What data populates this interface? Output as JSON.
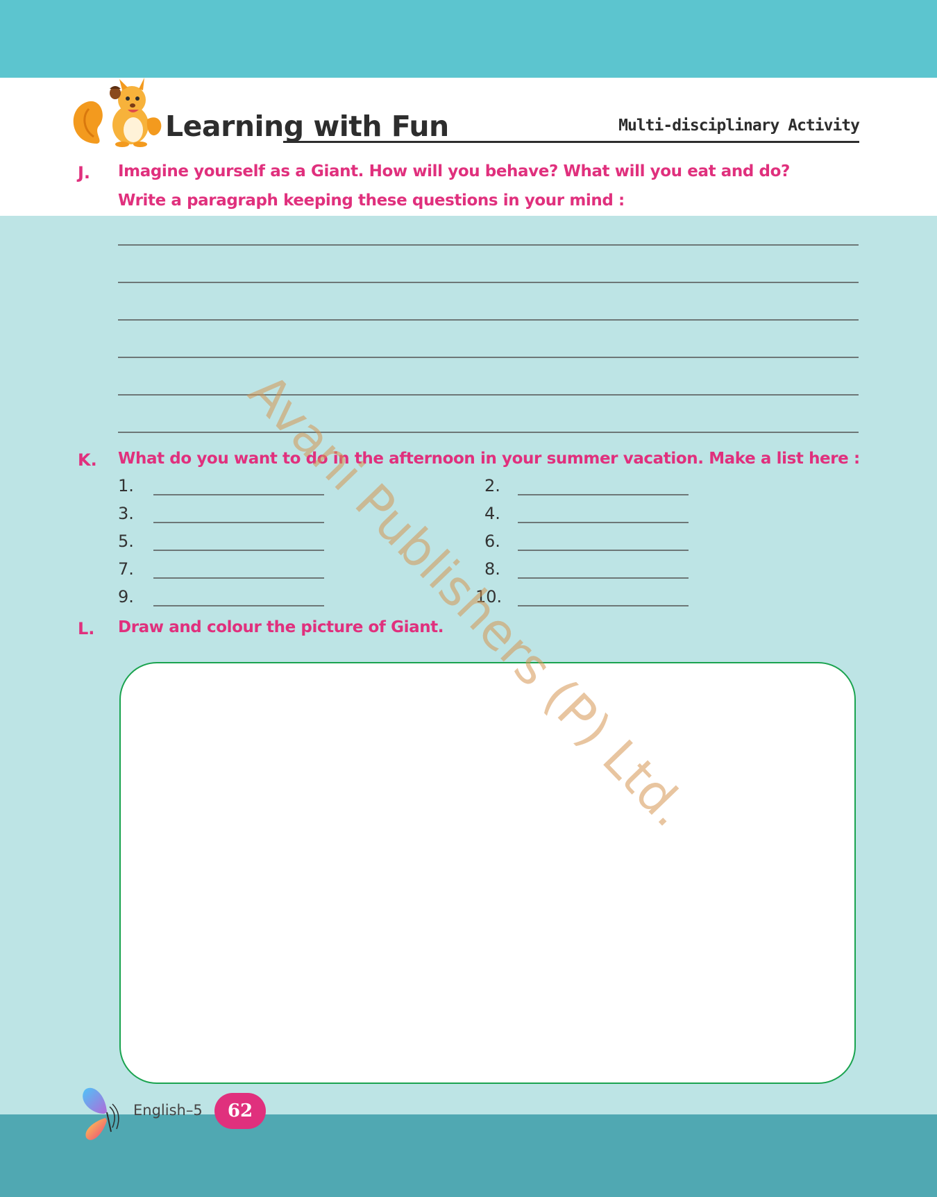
{
  "header": {
    "title_part1": "Learning ",
    "title_part2": "with Fun",
    "tag": "Multi-disciplinary Activity",
    "mascot_icon": "squirrel-icon"
  },
  "questions": {
    "j": {
      "letter": "J.",
      "line1": "Imagine yourself as a Giant. How will you behave? What will you eat and do?",
      "line2": "Write a paragraph keeping these questions in your mind :"
    },
    "k": {
      "letter": "K.",
      "text": "What do you want to do in the afternoon in your summer vacation. Make a list here :",
      "numbers": [
        "1.",
        "2.",
        "3.",
        "4.",
        "5.",
        "6.",
        "7.",
        "8.",
        "9.",
        "10."
      ]
    },
    "l": {
      "letter": "L.",
      "text": "Draw and colour the picture of Giant."
    }
  },
  "watermark": "Avani Publishers (P) Ltd.",
  "footer": {
    "subject": "English–5",
    "page_number": "62",
    "logo_icon": "butterfly-icon"
  },
  "colors": {
    "accent_pink": "#e0307d",
    "top_band": "#5cc5cf",
    "body_band": "#bde4e5",
    "bottom_band": "#50a8b2",
    "box_border": "#1aa34f"
  }
}
